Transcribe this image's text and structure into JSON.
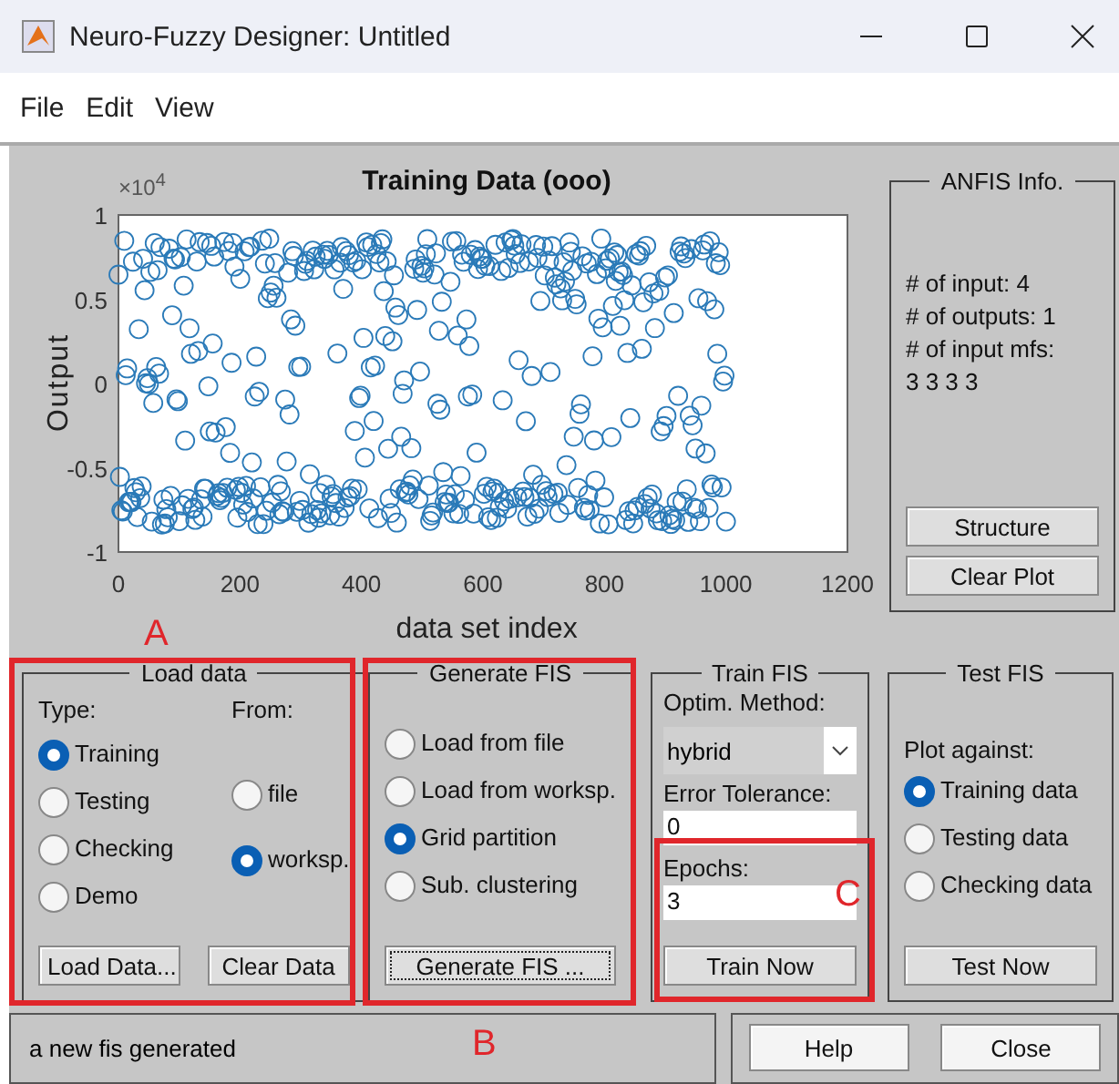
{
  "window": {
    "title": "Neuro-Fuzzy Designer: Untitled"
  },
  "menu": [
    "File",
    "Edit",
    "View"
  ],
  "plot": {
    "title": "Training Data (ooo)",
    "exponent": "×10$^{4}$",
    "ylabel": "Output",
    "xlabel": "data set index",
    "yticks": [
      "1",
      "0.5",
      "0",
      "-0.5",
      "-1"
    ],
    "xticks": [
      "0",
      "200",
      "400",
      "600",
      "800",
      "1000",
      "1200"
    ]
  },
  "anfis_info": {
    "title": "ANFIS Info.",
    "lines": [
      "# of input: 4",
      "# of outputs: 1",
      "# of input mfs:",
      "3  3  3  3"
    ],
    "buttons": [
      "Structure",
      "Clear Plot"
    ]
  },
  "load_data": {
    "title": "Load data",
    "type_label": "Type:",
    "types": [
      {
        "label": "Training",
        "selected": true
      },
      {
        "label": "Testing",
        "selected": false
      },
      {
        "label": "Checking",
        "selected": false
      },
      {
        "label": "Demo",
        "selected": false
      }
    ],
    "from_label": "From:",
    "sources": [
      {
        "label": "file",
        "selected": false
      },
      {
        "label": "worksp.",
        "selected": true
      }
    ],
    "buttons": [
      "Load Data...",
      "Clear Data"
    ]
  },
  "generate_fis": {
    "title": "Generate FIS",
    "options": [
      {
        "label": "Load from file",
        "selected": false
      },
      {
        "label": "Load from worksp.",
        "selected": false
      },
      {
        "label": "Grid partition",
        "selected": true
      },
      {
        "label": "Sub. clustering",
        "selected": false
      }
    ],
    "button": "Generate FIS ...",
    "focused": true
  },
  "train_fis": {
    "title": "Train FIS",
    "method_label": "Optim. Method:",
    "method": "hybrid",
    "tolerance_label": "Error Tolerance:",
    "tolerance": "0",
    "epochs_label": "Epochs:",
    "epochs": "3",
    "button": "Train Now"
  },
  "test_fis": {
    "title": "Test FIS",
    "plot_label": "Plot against:",
    "options": [
      {
        "label": "Training data",
        "selected": true
      },
      {
        "label": "Testing data",
        "selected": false
      },
      {
        "label": "Checking data",
        "selected": false
      }
    ],
    "button": "Test Now"
  },
  "status": "a new fis generated",
  "buttons": [
    "Help",
    "Close"
  ],
  "annotations": [
    {
      "label": "A"
    },
    {
      "label": "B"
    },
    {
      "label": "C"
    }
  ]
}
